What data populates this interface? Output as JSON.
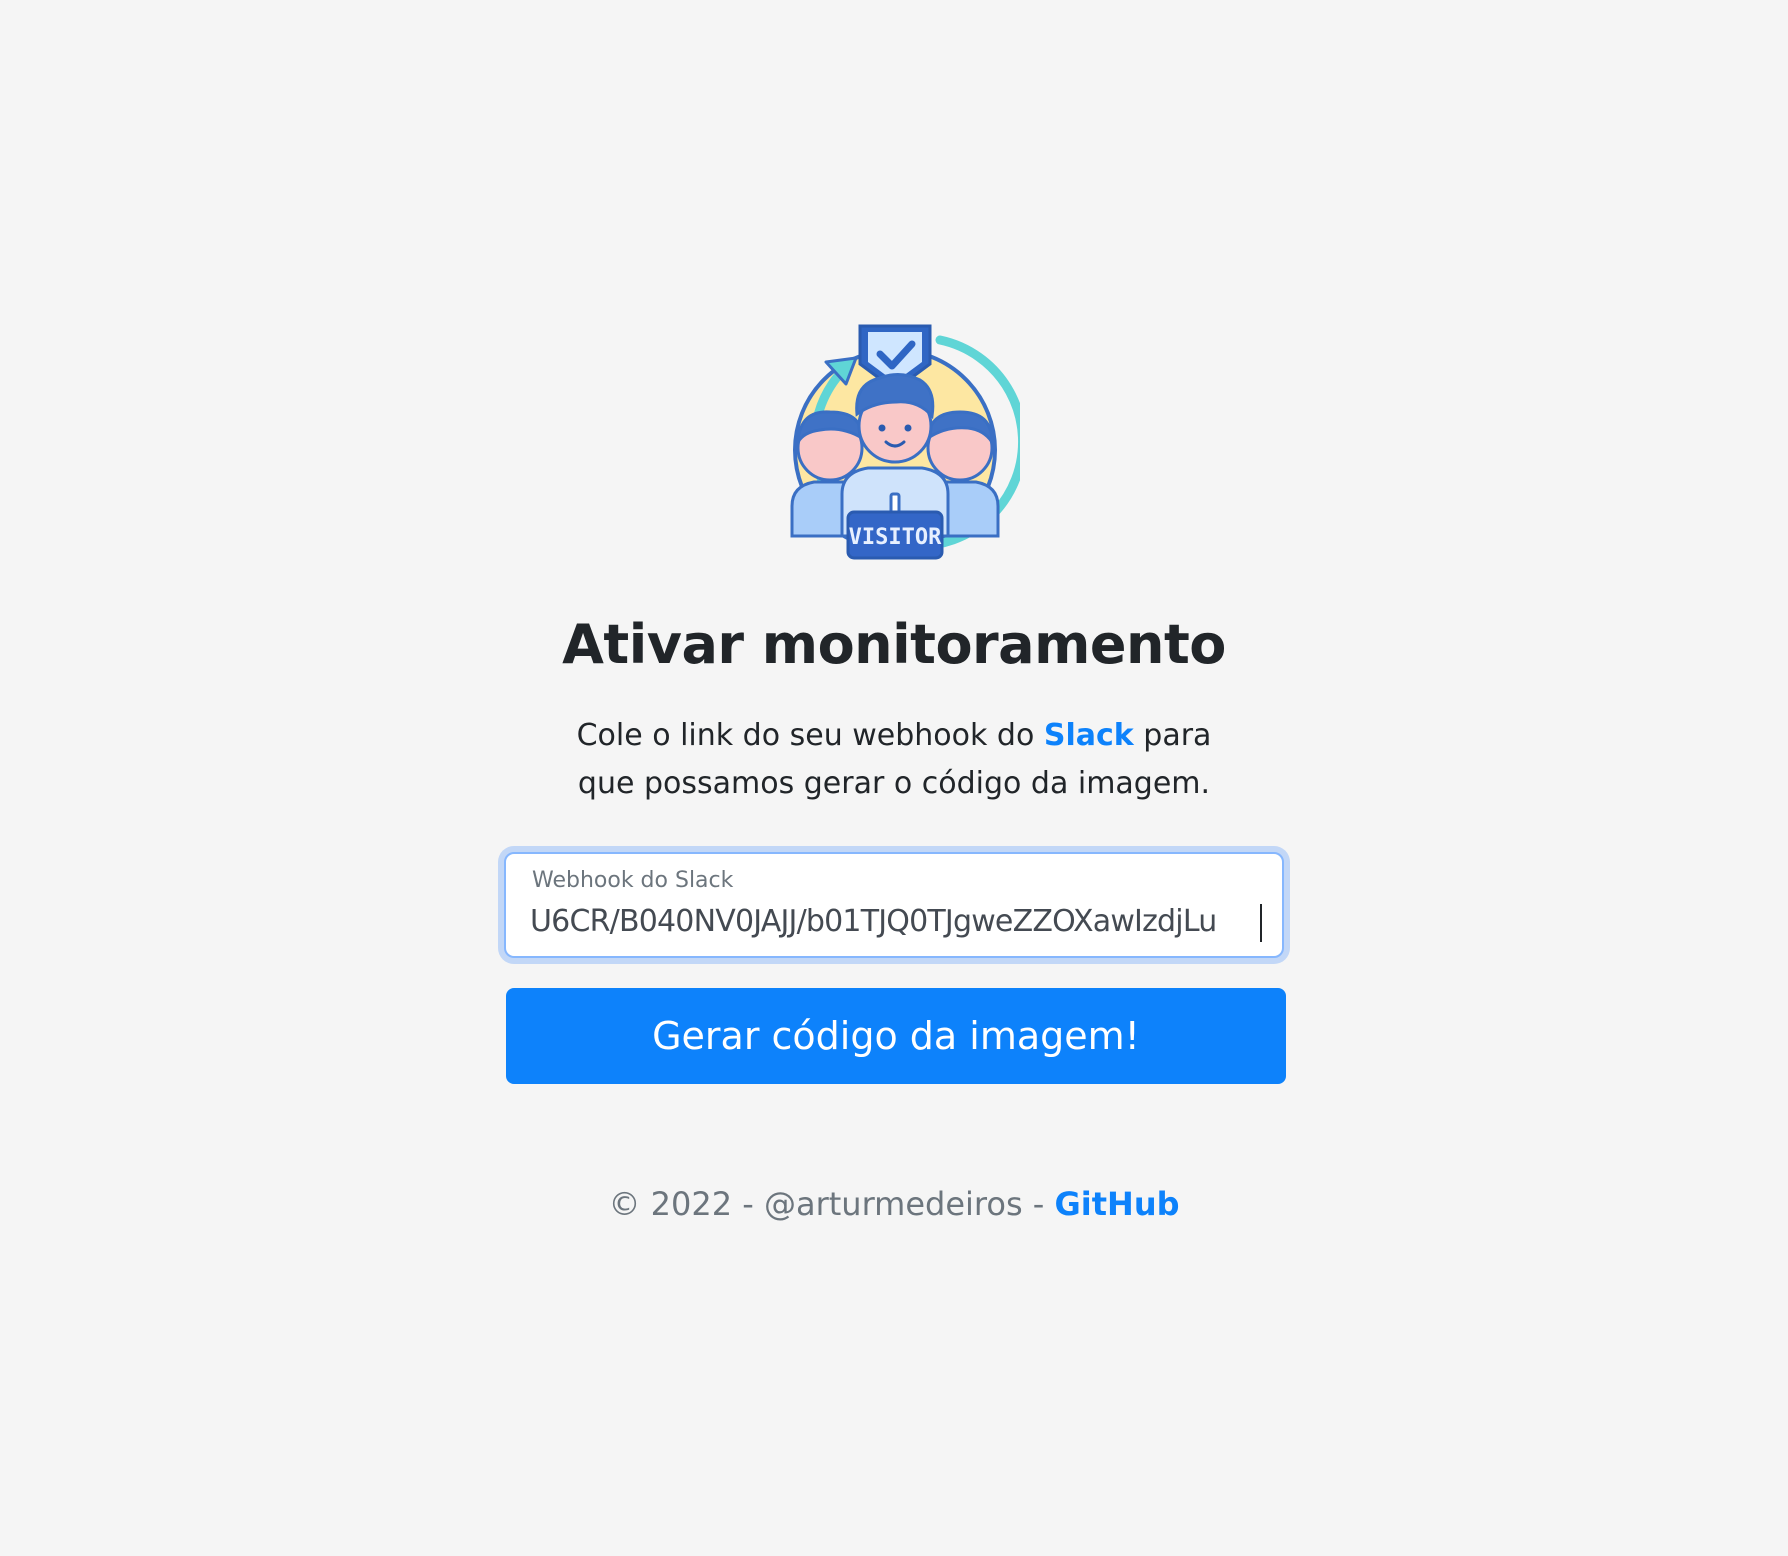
{
  "hero": {
    "badge_text": "VISITOR"
  },
  "heading": "Ativar monitoramento",
  "description": {
    "before": "Cole o link do seu webhook do ",
    "link": "Slack",
    "after": " para que possamos gerar o código da imagem."
  },
  "webhook_field": {
    "label": "Webhook do Slack",
    "value": "U6CR/B040NV0JAJJ/b01TJQ0TJgweZZOXawIzdjLu"
  },
  "submit_label": "Gerar código da imagem!",
  "footer": {
    "text": "© 2022 - @arturmedeiros - ",
    "link": "GitHub"
  },
  "colors": {
    "background": "#f5f5f5",
    "primary": "#0d82fb",
    "text": "#212529",
    "muted": "#6c757d"
  }
}
